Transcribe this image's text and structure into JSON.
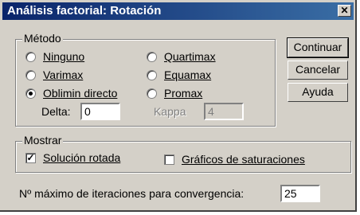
{
  "window": {
    "title": "Análisis factorial: Rotación",
    "close_glyph": "✕"
  },
  "method": {
    "group_label": "Método",
    "options": [
      {
        "label": "Ninguno",
        "checked": false
      },
      {
        "label": "Varimax",
        "checked": false
      },
      {
        "label": "Oblimin directo",
        "checked": true
      },
      {
        "label": "Quartimax",
        "checked": false
      },
      {
        "label": "Equamax",
        "checked": false
      },
      {
        "label": "Promax",
        "checked": false
      }
    ],
    "delta_label": "Delta:",
    "delta_value": "0",
    "kappa_label": "Kappa",
    "kappa_value": "4"
  },
  "buttons": {
    "continue": "Continuar",
    "cancel": "Cancelar",
    "help": "Ayuda"
  },
  "display": {
    "group_label": "Mostrar",
    "rotated_solution": "Solución rotada",
    "rotated_solution_checked": true,
    "loading_plots": "Gráficos de saturaciones",
    "loading_plots_checked": false
  },
  "iterations": {
    "label": "Nº máximo de iteraciones para convergencia:",
    "value": "25"
  }
}
